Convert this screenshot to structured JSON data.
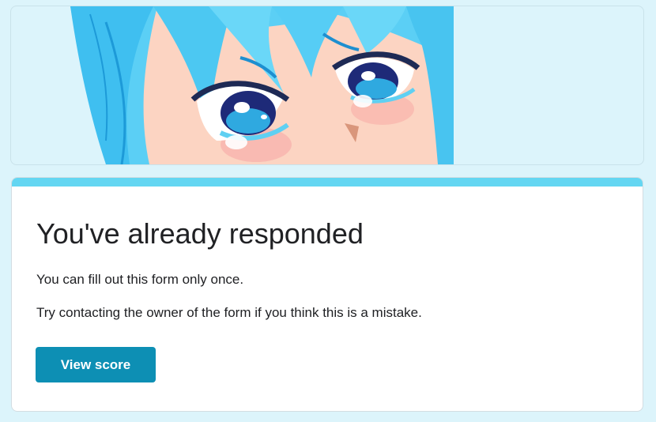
{
  "banner": {
    "image": "anime-character-crying-eyes-illustration"
  },
  "card": {
    "title": "You've already responded",
    "message_once": "You can fill out this form only once.",
    "message_contact": "Try contacting the owner of the form if you think this is a mistake.",
    "view_score_label": "View score"
  },
  "colors": {
    "page_background": "#dcf4fb",
    "card_accent": "#64d6f2",
    "button": "#0d8fb4",
    "text": "#202124"
  }
}
